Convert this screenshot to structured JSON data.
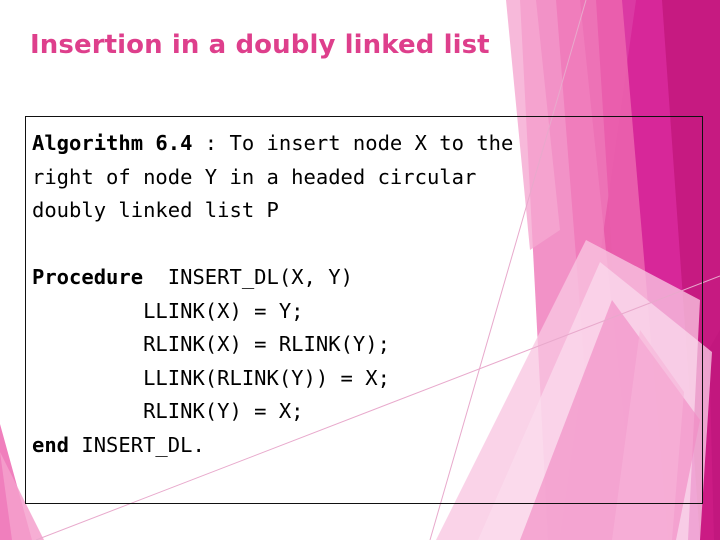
{
  "slide": {
    "title": "Insertion in a doubly linked list",
    "title_color": "#DE3F8C",
    "background_color": "#FFFFFF"
  },
  "content_box": {
    "border_color": "#111111",
    "lines": [
      {
        "id": "line-1",
        "bold_prefix": "Algorithm 6.4",
        "rest": " : To insert node X to the"
      },
      {
        "id": "line-2",
        "bold_prefix": "",
        "rest": "right of node Y in a headed circular"
      },
      {
        "id": "line-3",
        "bold_prefix": "",
        "rest": "doubly linked list P"
      },
      {
        "id": "line-blank",
        "bold_prefix": "",
        "rest": ""
      },
      {
        "id": "line-4",
        "bold_prefix": "Procedure",
        "rest": "  INSERT_DL(X, Y)"
      },
      {
        "id": "line-5",
        "bold_prefix": "",
        "rest": "         LLINK(X) = Y;"
      },
      {
        "id": "line-6",
        "bold_prefix": "",
        "rest": "         RLINK(X) = RLINK(Y);"
      },
      {
        "id": "line-7",
        "bold_prefix": "",
        "rest": "         LLINK(RLINK(Y)) = X;"
      },
      {
        "id": "line-8",
        "bold_prefix": "",
        "rest": "         RLINK(Y) = X;"
      },
      {
        "id": "line-9",
        "bold_prefix": "end",
        "rest": " INSERT_DL."
      }
    ]
  },
  "decoration": {
    "name": "pink-angular-ribbons",
    "palette": {
      "magenta_dark": "#C2177E",
      "magenta": "#D21B89",
      "pink_strong": "#E74FA3",
      "pink_mid": "#EF7EBB",
      "pink_light": "#F4A3CE",
      "pink_pale": "#F9CEE5",
      "pink_faint": "#FDEAF4",
      "hairline": "#E8A9CC"
    }
  }
}
